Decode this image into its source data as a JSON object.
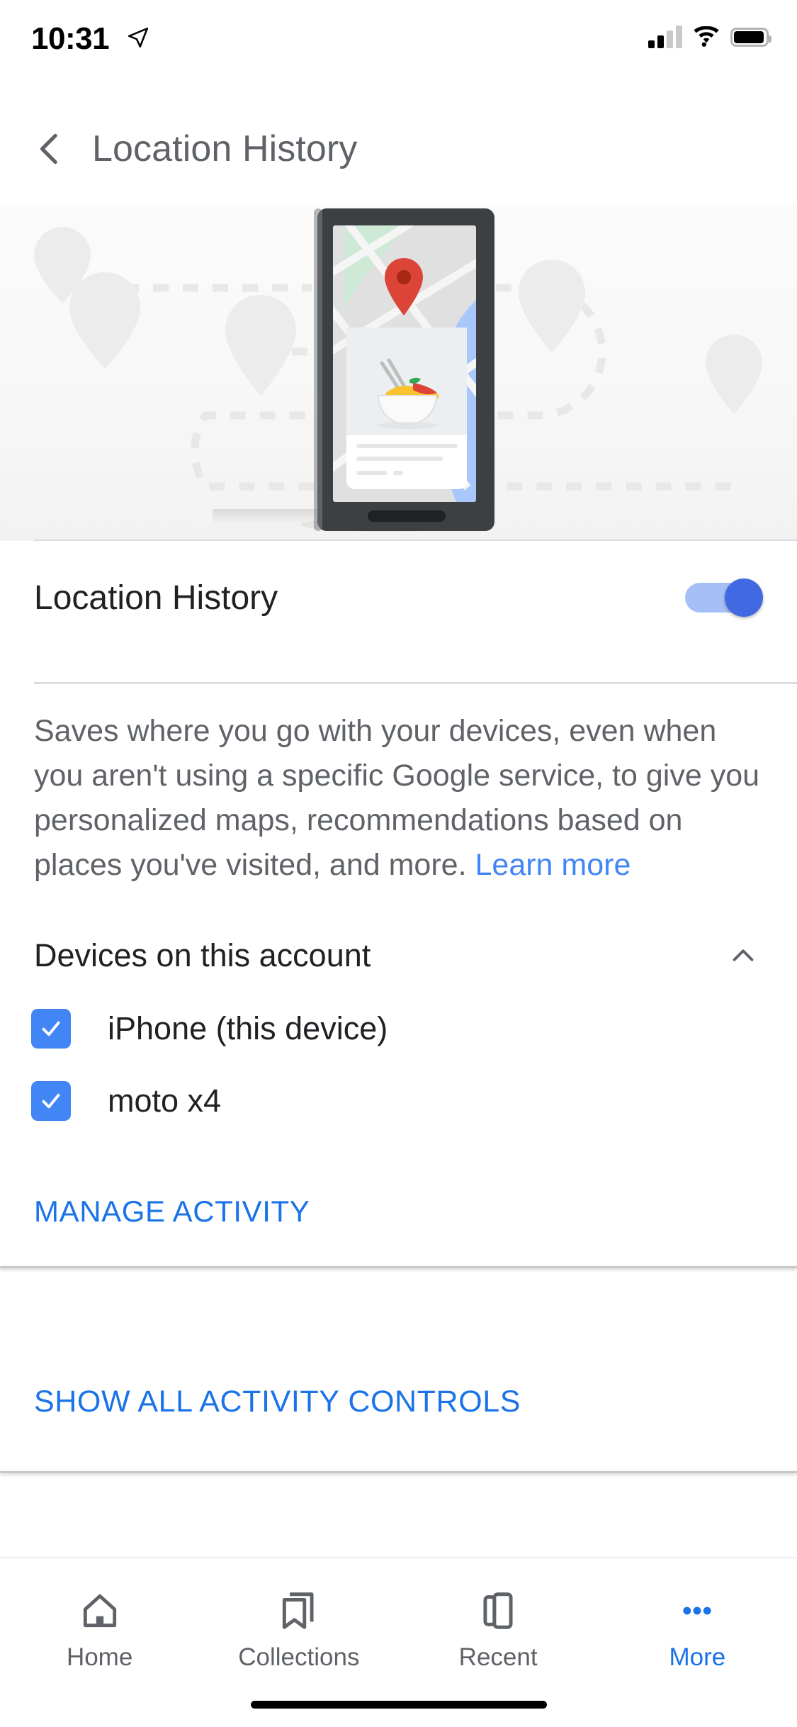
{
  "status_bar": {
    "time": "10:31",
    "location_icon": "location-arrow-icon",
    "signal_bars_filled": 2,
    "signal_bars_total": 4,
    "wifi_icon": "wifi-icon",
    "battery_icon": "battery-icon",
    "battery_level_pct": 95
  },
  "nav": {
    "back_icon": "back-chevron-icon",
    "title": "Location History"
  },
  "hero": {
    "illustration_name": "location-history-phone-map-illustration",
    "map_pin_color": "#DB4437",
    "phone_frame_color": "#3C4043",
    "park_color": "#CEEAD6",
    "water_color": "#A8C7FA",
    "pin_ghost_color": "#EDEDED"
  },
  "toggle_row": {
    "label": "Location History",
    "enabled": true,
    "track_color": "#A6C0F7",
    "knob_color": "#4169E1"
  },
  "description": {
    "text": "Saves where you go with your devices, even when you aren't using a specific Google service, to give you personalized maps, recommendations based on places you've visited, and more. ",
    "link_label": "Learn more",
    "link_color": "#4285F4"
  },
  "devices_section": {
    "header": "Devices on this account",
    "collapse_icon": "chevron-up-icon",
    "expanded": true,
    "checkbox_color": "#4285F4",
    "items": [
      {
        "label": "iPhone (this device)",
        "checked": true
      },
      {
        "label": "moto x4",
        "checked": true
      }
    ]
  },
  "actions": {
    "manage_activity": "MANAGE ACTIVITY",
    "show_all_activity_controls": "SHOW ALL ACTIVITY CONTROLS",
    "link_color": "#1A73E8"
  },
  "tab_bar": {
    "active_index": 3,
    "active_color": "#1A73E8",
    "inactive_color": "#5F6368",
    "tabs": [
      {
        "label": "Home",
        "icon": "home-icon"
      },
      {
        "label": "Collections",
        "icon": "bookmark-collections-icon"
      },
      {
        "label": "Recent",
        "icon": "recent-tabs-icon"
      },
      {
        "label": "More",
        "icon": "more-dots-icon"
      }
    ]
  }
}
